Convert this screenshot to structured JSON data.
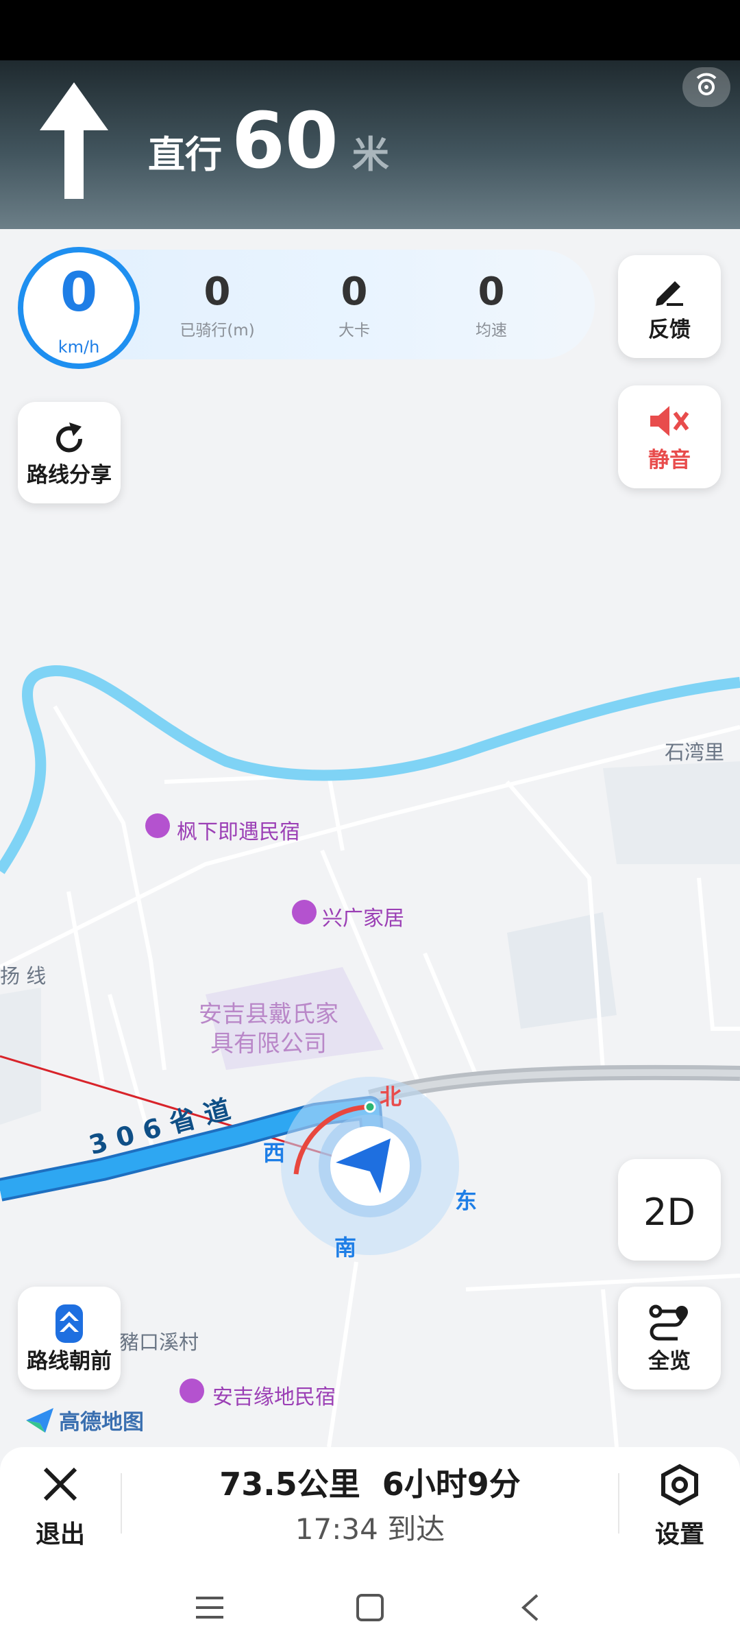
{
  "navigation": {
    "action": "直行",
    "distance": "60",
    "unit": "米",
    "turn_icon": "straight-arrow-icon",
    "satellite_icon": "satellite-icon"
  },
  "stats": {
    "speed": "0",
    "speed_unit": "km/h",
    "items": [
      {
        "value": "0",
        "label": "已骑行(m)"
      },
      {
        "value": "0",
        "label": "大卡"
      },
      {
        "value": "0",
        "label": "均速"
      }
    ]
  },
  "buttons": {
    "feedback": "反馈",
    "mute": "静音",
    "route_share": "路线分享",
    "mode_2d": "2D",
    "route_forward": "路线朝前",
    "overview": "全览"
  },
  "map": {
    "places": [
      "石湾里",
      "扬 线",
      "豬口溪村"
    ],
    "pois": [
      "枫下即遇民宿",
      "兴广家居",
      "安吉缘地民宿"
    ],
    "area_label_line1": "安吉县戴氏家",
    "area_label_line2": "具有限公司",
    "road_label": "306省道",
    "compass": {
      "north": "北",
      "south": "南",
      "east": "东",
      "west": "西"
    },
    "brand": "高德地图",
    "colors": {
      "route": "#2ea7f2",
      "river": "#7fd3f5",
      "accent": "#1e7ee6",
      "mute": "#e84c4c",
      "poi": "#9b3fb5"
    }
  },
  "trip": {
    "distance": "73.5公里",
    "duration": "6小时9分",
    "eta_time": "17:34",
    "eta_label": "到达",
    "exit": "退出",
    "settings": "设置"
  }
}
